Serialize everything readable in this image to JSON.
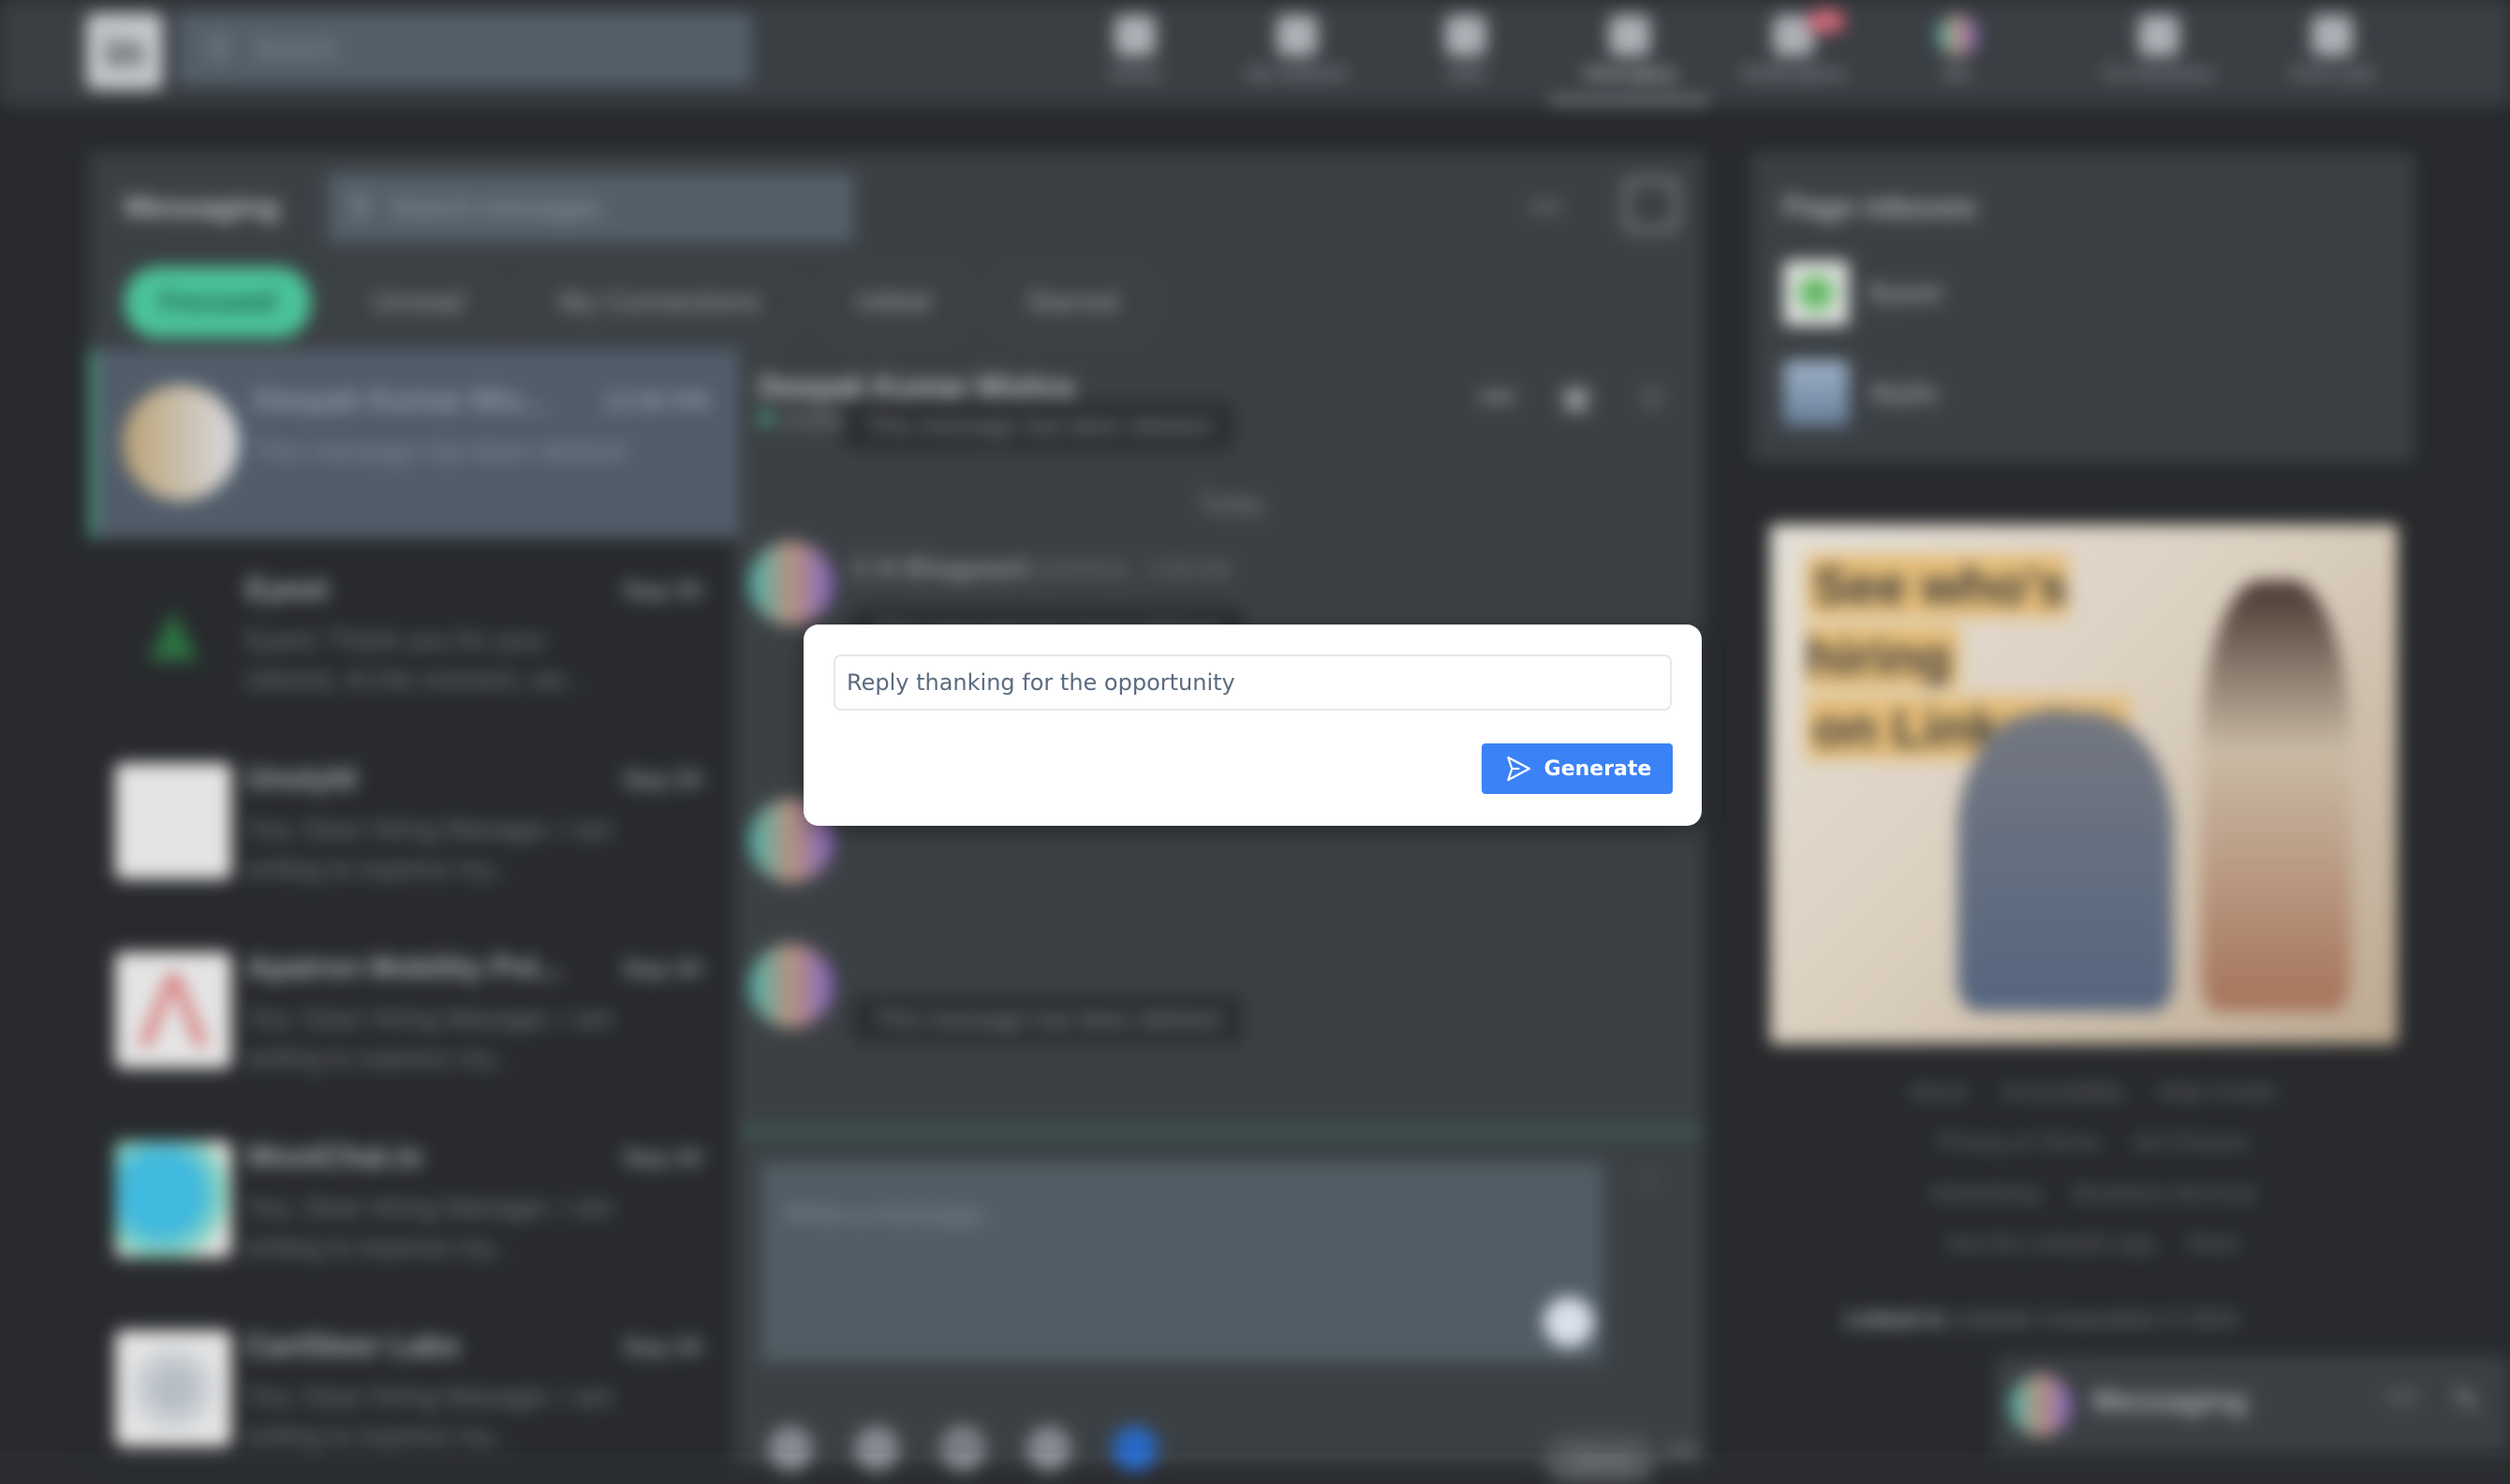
{
  "nav": {
    "logo": "in",
    "search_placeholder": "Search",
    "items": [
      {
        "label": "Home",
        "icon": "home-icon"
      },
      {
        "label": "My Network",
        "icon": "network-icon"
      },
      {
        "label": "Jobs",
        "icon": "briefcase-icon"
      },
      {
        "label": "Messaging",
        "icon": "messaging-icon",
        "active": true
      },
      {
        "label": "Notifications",
        "icon": "bell-icon",
        "badge": "10"
      },
      {
        "label": "Me",
        "icon": "avatar-icon"
      },
      {
        "label": "For Business",
        "icon": "grid-icon"
      },
      {
        "label": "Post a job",
        "icon": "post-job-icon"
      }
    ]
  },
  "messaging": {
    "title": "Messaging",
    "search_placeholder": "Search messages",
    "filters": [
      "Focused",
      "Unread",
      "My Connections",
      "InMail",
      "Starred"
    ],
    "conversations": [
      {
        "name": "Deepak Kumar Mis...",
        "date": "12:00 PM",
        "preview": "This message has been deleted"
      },
      {
        "name": "Eyeot",
        "date": "Sep 24",
        "preview": "Eyeot: Thank you for your interest. At the moment, we..."
      },
      {
        "name": "Unstyld",
        "date": "Sep 24",
        "preview": "You: Dear Hiring Manager, I am writing to express my..."
      },
      {
        "name": "Apatron Mobility Pvt...",
        "date": "Sep 24",
        "preview": "You: Dear Hiring Manager, I am writing to express my..."
      },
      {
        "name": "WootChat.io",
        "date": "Sep 24",
        "preview": "You: Dear Hiring Manager, I am writing to express my..."
      },
      {
        "name": "CartSteer Labs",
        "date": "Sep 24",
        "preview": "You: Dear Hiring Manager, I am writing to express my..."
      }
    ]
  },
  "chat": {
    "contact_name": "Deepak Kumar Mishra",
    "status": "Available on mobile",
    "deleted_text": "This message has been deleted",
    "day_label": "Today",
    "sender": "C D Bhagwant",
    "sender_meta": "(He/Him) · 1:00 AM",
    "composer_placeholder": "Write a message...",
    "send_label": "Send",
    "toolbar": [
      "image-icon",
      "attach-icon",
      "GIF",
      "emoji-icon",
      "ai-icon"
    ]
  },
  "right": {
    "inbox_title": "Page inboxes",
    "inboxes": [
      "Eyeot",
      "Styliz"
    ],
    "ad_line1": "See who's hiring",
    "ad_line2": "on LinkedIn.",
    "footer_links": [
      "About",
      "Accessibility",
      "Help Center",
      "Privacy & Terms",
      "Ad Choices",
      "Advertising",
      "Business Services",
      "Get the LinkedIn app",
      "More"
    ],
    "copyright_brand": "Linked in",
    "copyright": "LinkedIn Corporation © 2024",
    "dock_label": "Messaging"
  },
  "modal": {
    "input_value": "Reply thanking for the opportunity",
    "generate_label": "Generate",
    "accent": "#3b82f6"
  }
}
